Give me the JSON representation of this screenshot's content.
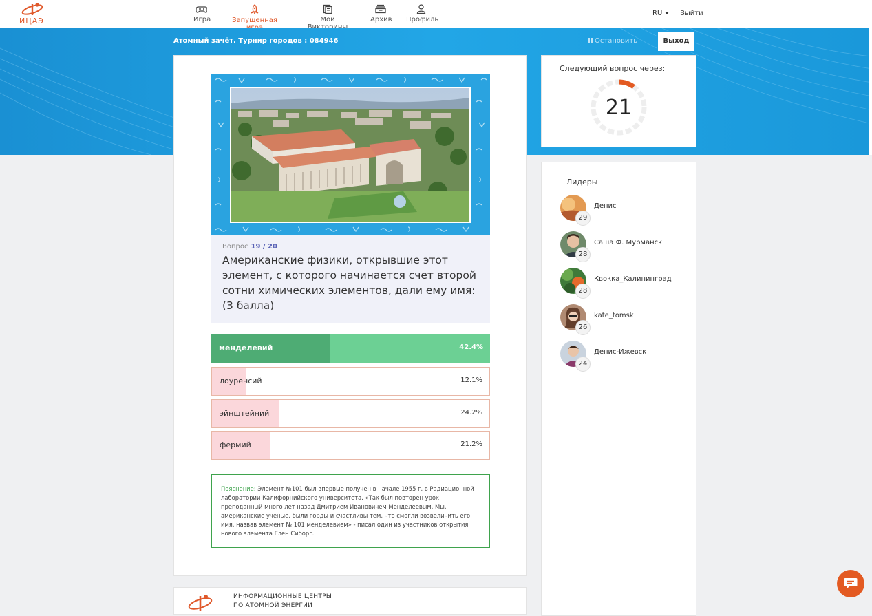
{
  "logo": {
    "text": "ИЦАЭ"
  },
  "nav": {
    "items": [
      {
        "label": "Игра",
        "icon": "gamepad-icon"
      },
      {
        "label": "Запущенная игра",
        "icon": "rocket-icon",
        "active": true
      },
      {
        "label": "Мои Викторины",
        "icon": "quizzes-icon"
      },
      {
        "label": "Архив",
        "icon": "archive-icon"
      },
      {
        "label": "Профиль",
        "icon": "user-icon"
      }
    ],
    "lang": "RU",
    "logout": "Выйти"
  },
  "header": {
    "game_title": "Атомный зачёт. Турнир городов : 084946",
    "stop_label": "Остановить",
    "exit_label": "Выход"
  },
  "question": {
    "number_label": "Вопрос",
    "number_value": "19 / 20",
    "text": "Американские физики, открывшие этот элемент, с которого начинается счет второй сотни химических элементов, дали ему имя: (3 балла)"
  },
  "answers": [
    {
      "label": "менделевий",
      "percent": "42.4%",
      "value": 42.4,
      "correct": true
    },
    {
      "label": "лоуренсий",
      "percent": "12.1%",
      "value": 12.1,
      "correct": false
    },
    {
      "label": "эйнштейний",
      "percent": "24.2%",
      "value": 24.2,
      "correct": false
    },
    {
      "label": "фермий",
      "percent": "21.2%",
      "value": 21.2,
      "correct": false
    }
  ],
  "explanation": {
    "label": "Пояснение:",
    "text": "Элемент №101 был впервые получен в начале 1955 г. в Радиационной лаборатории Калифорнийского университета. «Так был повторен урок, преподанный много лет назад Дмитрием Ивановичем Менделеевым. Мы, американские ученые, были горды и счастливы тем, что смогли возвеличить его имя, назвав элемент № 101 менделевием» - писал один из участников открытия нового элемента Глен Сиборг."
  },
  "timer": {
    "title": "Следующий вопрос через:",
    "seconds": "21",
    "remaining_fraction": 0.1
  },
  "leaders": {
    "title": "Лидеры",
    "items": [
      {
        "name": "Денис",
        "score": "29"
      },
      {
        "name": "Саша Ф. Мурманск",
        "score": "28"
      },
      {
        "name": "Квокка_Калининград",
        "score": "28"
      },
      {
        "name": "kate_tomsk",
        "score": "26"
      },
      {
        "name": "Денис-Ижевск",
        "score": "24"
      }
    ]
  },
  "footer": {
    "line1": "ИНФОРМАЦИОННЫЕ ЦЕНТРЫ",
    "line2": "ПО АТОМНОЙ ЭНЕРГИИ"
  },
  "colors": {
    "accent": "#e0582a",
    "banner": "#1e9ee0",
    "correct": "#6cd094",
    "wrong_fill": "#fbd7db"
  }
}
